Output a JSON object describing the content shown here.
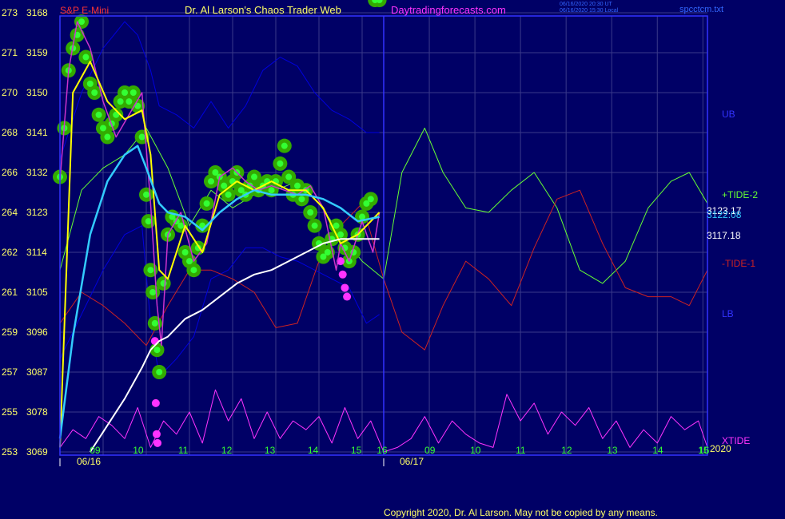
{
  "header": {
    "symbol": "S&P E-Mini",
    "title": "Dr. Al Larson's Chaos Trader Web",
    "site": "Daytradingforecasts.com",
    "stamp1": "06/16/2020 20:30 UT",
    "stamp2": "06/16/2020 15:30 Local",
    "file": "spcctcm.txt"
  },
  "footer": {
    "copyright": "Copyright 2020, Dr. Al Larson. May not be copied by any means."
  },
  "colors": {
    "background": "#000066",
    "frame": "#3333ff",
    "grid": "#3a3a8a",
    "price": "#cc33cc",
    "flux_dots": "#00cc00",
    "negative_dots": "#ff33ff",
    "fast_ma": "#ffff00",
    "mid_ma": "#33ccff",
    "slow_ma": "#ffffff",
    "bands": "#0000dd",
    "tide2": "#66ff33",
    "tide1": "#cc2222",
    "xtide": "#ff33ff"
  },
  "chart_data": {
    "type": "line",
    "title": "S&P E-Mini",
    "y_axis_left": {
      "secondary_labels": [
        "273",
        "271",
        "270",
        "268",
        "266",
        "264",
        "262",
        "261",
        "259",
        "257",
        "255",
        "253"
      ],
      "ticks": [
        3168,
        3159,
        3150,
        3141,
        3132,
        3123,
        3114,
        3105,
        3096,
        3087,
        3078,
        3069
      ],
      "ylim": [
        3069,
        3168
      ]
    },
    "x_axis": {
      "hour_ticks": [
        "09",
        "10",
        "11",
        "12",
        "13",
        "14",
        "15",
        "16",
        "09",
        "10",
        "11",
        "12",
        "13",
        "14",
        "15",
        "16"
      ],
      "date_labels": [
        "06/16",
        "06/17"
      ],
      "year_label": "2020"
    },
    "right_labels": [
      {
        "text": "UB",
        "color": "#3333ff"
      },
      {
        "text": "+TIDE-2",
        "color": "#66ff33"
      },
      {
        "text": "3123.17",
        "color": "#ffffff"
      },
      {
        "text": "3122.08",
        "color": "#33ccff"
      },
      {
        "text": "3117.18",
        "color": "#ffffff"
      },
      {
        "text": "-TIDE-1",
        "color": "#cc2222"
      },
      {
        "text": "LB",
        "color": "#3333ff"
      },
      {
        "text": "XTIDE",
        "color": "#ff33ff"
      }
    ],
    "series": [
      {
        "name": "price",
        "hours": [
          8.5,
          8.7,
          8.9,
          9.2,
          9.5,
          9.8,
          10.1,
          10.4,
          10.6,
          10.75,
          10.85,
          11.0,
          11.3,
          11.6,
          11.9,
          12.2,
          12.5,
          12.8,
          13.1,
          13.4,
          13.7,
          14.0,
          14.3,
          14.6,
          14.9,
          15.0,
          15.2,
          15.5,
          15.75,
          15.9
        ],
        "values": [
          3130,
          3155,
          3166,
          3160,
          3148,
          3140,
          3145,
          3150,
          3125,
          3102,
          3093,
          3118,
          3123,
          3112,
          3116,
          3131,
          3133,
          3130,
          3128,
          3129,
          3128,
          3127,
          3129,
          3124,
          3110,
          3116,
          3112,
          3121,
          3114,
          3123
        ]
      },
      {
        "name": "fast",
        "hours": [
          8.5,
          8.8,
          9.2,
          9.6,
          10.0,
          10.4,
          10.6,
          10.8,
          11.0,
          11.4,
          11.8,
          12.2,
          12.6,
          13.0,
          13.4,
          13.8,
          14.2,
          14.6,
          15.0,
          15.4,
          15.9
        ],
        "values": [
          3070,
          3150,
          3157,
          3148,
          3144,
          3146,
          3136,
          3110,
          3108,
          3120,
          3114,
          3127,
          3130,
          3128,
          3130,
          3128,
          3128,
          3124,
          3116,
          3118,
          3123
        ]
      },
      {
        "name": "mid",
        "hours": [
          8.5,
          8.8,
          9.2,
          9.6,
          10.0,
          10.3,
          10.5,
          10.8,
          11.0,
          11.4,
          11.8,
          12.2,
          12.6,
          13.0,
          13.4,
          13.8,
          14.2,
          14.6,
          15.0,
          15.4,
          15.9
        ],
        "values": [
          3072,
          3095,
          3118,
          3130,
          3136,
          3138,
          3133,
          3125,
          3123,
          3122,
          3119,
          3123,
          3126,
          3128,
          3127,
          3127,
          3127,
          3126,
          3124,
          3121,
          3122
        ]
      },
      {
        "name": "slow",
        "hours": [
          9.2,
          9.6,
          10.0,
          10.4,
          10.6,
          10.8,
          11.0,
          11.4,
          11.8,
          12.2,
          12.6,
          13.0,
          13.4,
          13.8,
          14.2,
          14.6,
          15.0,
          15.4,
          15.9
        ],
        "values": [
          3069,
          3075,
          3081,
          3088,
          3092,
          3094,
          3095,
          3099,
          3101,
          3104,
          3107,
          3109,
          3110,
          3112,
          3114,
          3116,
          3117,
          3117,
          3117
        ]
      },
      {
        "name": "UB",
        "hours": [
          8.5,
          9.0,
          9.5,
          10.0,
          10.3,
          10.6,
          10.8,
          11.2,
          11.6,
          12.0,
          12.4,
          12.8,
          13.2,
          13.6,
          14.0,
          14.4,
          14.8,
          15.2,
          15.6,
          15.9
        ],
        "values": [
          3135,
          3150,
          3160,
          3166,
          3163,
          3155,
          3147,
          3145,
          3142,
          3148,
          3142,
          3147,
          3155,
          3158,
          3156,
          3150,
          3146,
          3144,
          3141,
          3141
        ]
      },
      {
        "name": "LB",
        "hours": [
          8.5,
          9.0,
          9.5,
          10.0,
          10.4,
          10.6,
          10.8,
          11.2,
          11.6,
          12.0,
          12.4,
          12.8,
          13.2,
          13.6,
          14.0,
          14.4,
          14.8,
          15.2,
          15.6,
          15.9
        ],
        "values": [
          3090,
          3100,
          3110,
          3118,
          3120,
          3098,
          3086,
          3090,
          3095,
          3108,
          3110,
          3115,
          3115,
          3113,
          3112,
          3110,
          3108,
          3106,
          3098,
          3100
        ]
      },
      {
        "name": "+TIDE-2",
        "hours": [
          8.5,
          9.0,
          9.5,
          10.0,
          10.5,
          11.0,
          11.5,
          12.0,
          12.5,
          13.0,
          13.5,
          14.0,
          14.5,
          15.0,
          15.5,
          16.0,
          16.4,
          16.9,
          17.3,
          17.8,
          18.3,
          18.8,
          19.3,
          19.8,
          20.3,
          20.8,
          21.3,
          21.8,
          22.3,
          22.7,
          23.1
        ],
        "values": [
          3110,
          3128,
          3133,
          3136,
          3142,
          3133,
          3120,
          3128,
          3124,
          3127,
          3128,
          3130,
          3125,
          3118,
          3112,
          3108,
          3132,
          3142,
          3132,
          3124,
          3123,
          3128,
          3132,
          3124,
          3110,
          3107,
          3112,
          3124,
          3130,
          3132,
          3125
        ]
      },
      {
        "name": "-TIDE-1",
        "hours": [
          8.5,
          9.0,
          9.5,
          10.0,
          10.5,
          11.0,
          11.5,
          12.0,
          12.5,
          13.0,
          13.5,
          14.0,
          14.5,
          15.0,
          15.5,
          16.0,
          16.4,
          16.9,
          17.3,
          17.8,
          18.3,
          18.8,
          19.3,
          19.8,
          20.3,
          20.8,
          21.3,
          21.8,
          22.3,
          22.7,
          23.1
        ],
        "values": [
          3098,
          3105,
          3102,
          3098,
          3093,
          3102,
          3110,
          3110,
          3108,
          3105,
          3097,
          3098,
          3112,
          3120,
          3125,
          3108,
          3096,
          3092,
          3102,
          3112,
          3108,
          3102,
          3115,
          3126,
          3128,
          3116,
          3106,
          3104,
          3104,
          3102,
          3110
        ]
      },
      {
        "name": "XTIDE",
        "hours": [
          8.5,
          8.8,
          9.1,
          9.4,
          9.7,
          10.0,
          10.3,
          10.6,
          10.9,
          11.2,
          11.5,
          11.8,
          12.1,
          12.4,
          12.7,
          13.0,
          13.3,
          13.6,
          13.9,
          14.2,
          14.5,
          14.8,
          15.1,
          15.4,
          15.7,
          16.0,
          16.3,
          16.6,
          16.9,
          17.2,
          17.5,
          17.8,
          18.1,
          18.4,
          18.7,
          19.0,
          19.3,
          19.6,
          19.9,
          20.2,
          20.5,
          20.8,
          21.1,
          21.4,
          21.7,
          22.0,
          22.3,
          22.6,
          22.9,
          23.1
        ],
        "values": [
          3070,
          3074,
          3072,
          3077,
          3075,
          3072,
          3079,
          3070,
          3076,
          3073,
          3078,
          3071,
          3083,
          3076,
          3081,
          3072,
          3078,
          3072,
          3076,
          3074,
          3077,
          3071,
          3079,
          3072,
          3076,
          3069,
          3070,
          3072,
          3077,
          3071,
          3076,
          3073,
          3071,
          3070,
          3082,
          3076,
          3080,
          3073,
          3078,
          3075,
          3079,
          3072,
          3076,
          3070,
          3074,
          3071,
          3077,
          3074,
          3076,
          3070
        ]
      }
    ],
    "flux_hours": [
      8.5,
      8.6,
      8.7,
      8.8,
      8.9,
      9.0,
      9.1,
      9.2,
      9.3,
      9.4,
      9.5,
      9.6,
      9.7,
      9.8,
      9.9,
      10.0,
      10.1,
      10.2,
      10.3,
      10.4,
      10.5,
      10.55,
      10.6,
      10.65,
      10.7,
      10.75,
      10.8,
      10.9,
      11.0,
      11.1,
      11.2,
      11.3,
      11.4,
      11.5,
      11.6,
      11.7,
      11.8,
      11.9,
      12.0,
      12.1,
      12.2,
      12.3,
      12.4,
      12.5,
      12.6,
      12.7,
      12.8,
      12.9,
      13.0,
      13.1,
      13.2,
      13.3,
      13.4,
      13.5,
      13.6,
      13.7,
      13.8,
      13.9,
      14.0,
      14.1,
      14.2,
      14.3,
      14.4,
      14.5,
      14.6,
      14.7,
      14.8,
      14.9,
      15.0,
      15.1,
      15.2,
      15.3,
      15.4,
      15.5,
      15.6,
      15.7,
      15.8,
      15.9
    ],
    "flux_values": [
      3131,
      3142,
      3155,
      3160,
      3163,
      3166,
      3158,
      3152,
      3150,
      3145,
      3142,
      3140,
      3143,
      3145,
      3148,
      3150,
      3148,
      3150,
      3147,
      3140,
      3127,
      3121,
      3110,
      3105,
      3098,
      3092,
      3087,
      3107,
      3118,
      3122,
      3121,
      3120,
      3114,
      3112,
      3110,
      3115,
      3120,
      3125,
      3130,
      3132,
      3131,
      3129,
      3127,
      3130,
      3132,
      3128,
      3127,
      3129,
      3131,
      3128,
      3129,
      3130,
      3128,
      3130,
      3134,
      3138,
      3131,
      3127,
      3129,
      3126,
      3128,
      3123,
      3120,
      3116,
      3113,
      3114,
      3117,
      3120,
      3118,
      3115,
      3112,
      3114,
      3118,
      3122,
      3125,
      3126
    ],
    "negative_dot_hours": [
      10.7,
      10.72,
      10.74,
      10.76,
      15.0,
      15.05,
      15.1,
      15.15
    ],
    "negative_dot_values": [
      3094,
      3080,
      3073,
      3071,
      3112,
      3109,
      3106,
      3104
    ]
  }
}
